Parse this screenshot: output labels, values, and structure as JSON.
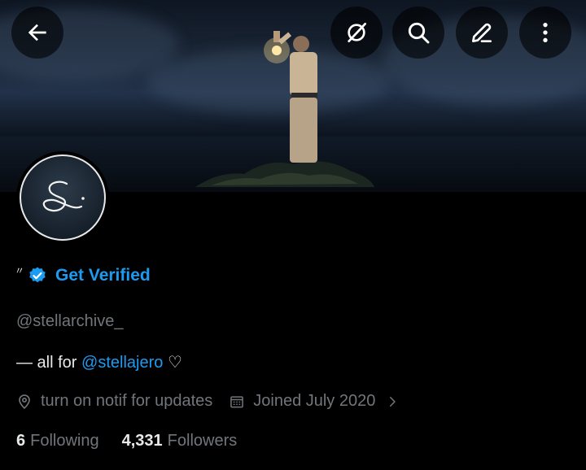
{
  "profile": {
    "name_mark": "〃",
    "get_verified_label": "Get Verified",
    "handle": "@stellarchive_",
    "bio_prefix": "— all for",
    "bio_mention": "@stellajero",
    "bio_suffix": "♡",
    "location": "turn on notif for updates",
    "joined": "Joined July 2020",
    "following_count": "6",
    "following_label": "Following",
    "followers_count": "4,331",
    "followers_label": "Followers"
  },
  "icons": {
    "back": "back-arrow-icon",
    "grok": "grok-icon",
    "search": "search-icon",
    "edit": "edit-icon",
    "more": "more-vertical-icon",
    "verified": "verified-badge-icon",
    "location": "location-pin-icon",
    "calendar": "calendar-icon",
    "chevron": "chevron-right-icon"
  },
  "colors": {
    "accent": "#1d9bf0",
    "text_primary": "#e7e9ea",
    "text_secondary": "#71767b",
    "background": "#000000"
  }
}
